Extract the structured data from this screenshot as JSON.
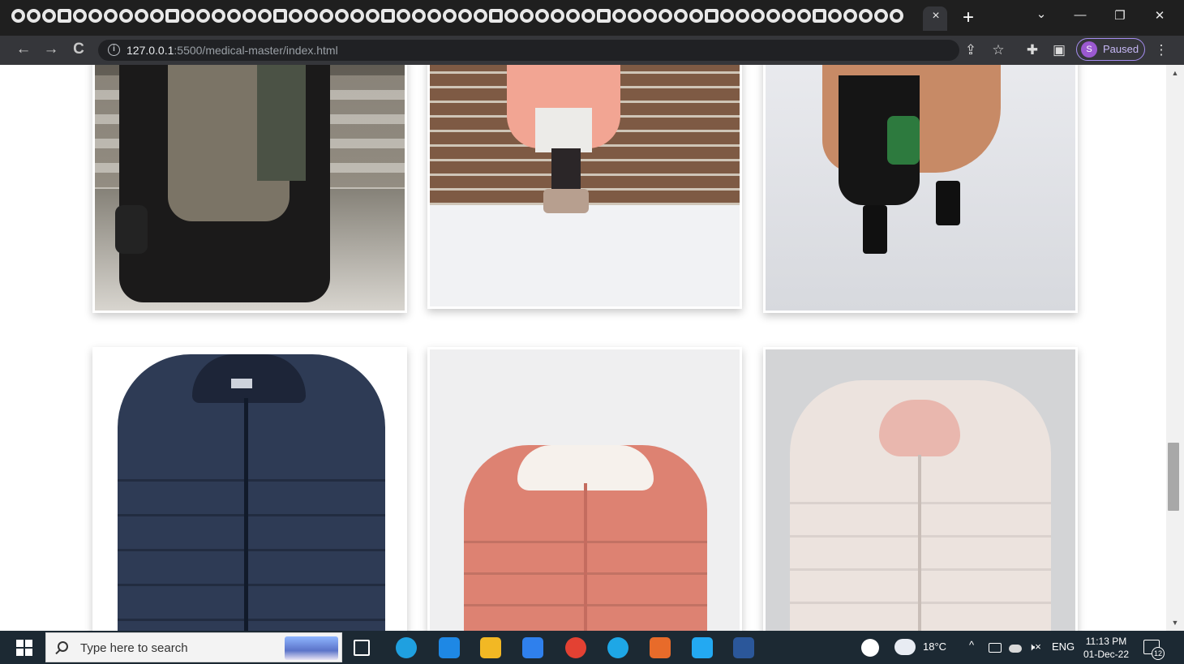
{
  "browser": {
    "tab_close_glyph": "×",
    "new_tab_glyph": "+",
    "tab_search_glyph": "⌄",
    "minimize_glyph": "—",
    "restore_glyph": "❐",
    "close_glyph": "✕",
    "back_glyph": "←",
    "forward_glyph": "→",
    "reload_glyph": "C",
    "info_glyph": "i",
    "url_host": "127.0.0.1",
    "url_rest": ":5500/medical-master/index.html",
    "share_glyph": "⇪",
    "star_glyph": "☆",
    "extensions_glyph": "✚",
    "sidepanel_glyph": "▣",
    "menu_glyph": "⋮",
    "profile_initial": "S",
    "profile_status": "Paused",
    "profile_color": "#9b59d0"
  },
  "gallery": {
    "items": [
      {
        "subject": "man in dark coat and grey scarf in falling snow"
      },
      {
        "subject": "pink fur coat against brick wall in snow"
      },
      {
        "subject": "fur coat and black boots walking on snow"
      },
      {
        "subject": "navy hooded puffer jacket"
      },
      {
        "subject": "coral puffer jacket with fur-trimmed hood"
      },
      {
        "subject": "blush pink hooded puffer jacket"
      }
    ]
  },
  "scrollbar": {
    "up_glyph": "▲",
    "down_glyph": "▼"
  },
  "taskbar": {
    "search_placeholder": "Type here to search",
    "weather_temp": "18°C",
    "tray_chevron": "^",
    "language": "ENG",
    "volume_glyph": "🕨×",
    "time": "11:13 PM",
    "date": "01-Dec-22",
    "notification_count": "12",
    "app_colors": {
      "edge": "#1fa0e0",
      "mail": "#1e88e5",
      "files": "#f2b824",
      "store": "#2f80ed",
      "chrome": "#e34133",
      "canva": "#1ea7e6",
      "office": "#e86b2a",
      "vscode": "#23a9f2",
      "word": "#2b579a"
    }
  }
}
